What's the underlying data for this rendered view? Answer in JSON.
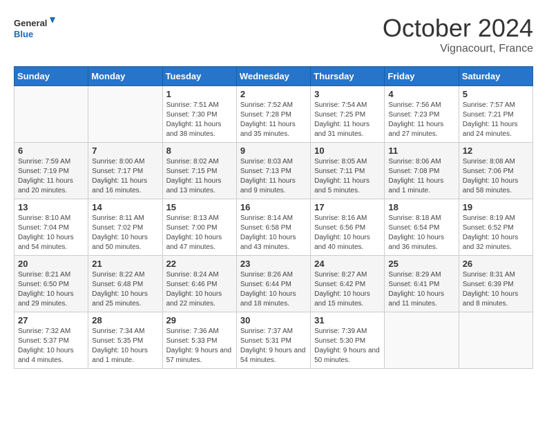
{
  "header": {
    "logo_line1": "General",
    "logo_line2": "Blue",
    "month": "October 2024",
    "location": "Vignacourt, France"
  },
  "weekdays": [
    "Sunday",
    "Monday",
    "Tuesday",
    "Wednesday",
    "Thursday",
    "Friday",
    "Saturday"
  ],
  "weeks": [
    [
      {
        "day": "",
        "info": ""
      },
      {
        "day": "",
        "info": ""
      },
      {
        "day": "1",
        "info": "Sunrise: 7:51 AM\nSunset: 7:30 PM\nDaylight: 11 hours and 38 minutes."
      },
      {
        "day": "2",
        "info": "Sunrise: 7:52 AM\nSunset: 7:28 PM\nDaylight: 11 hours and 35 minutes."
      },
      {
        "day": "3",
        "info": "Sunrise: 7:54 AM\nSunset: 7:25 PM\nDaylight: 11 hours and 31 minutes."
      },
      {
        "day": "4",
        "info": "Sunrise: 7:56 AM\nSunset: 7:23 PM\nDaylight: 11 hours and 27 minutes."
      },
      {
        "day": "5",
        "info": "Sunrise: 7:57 AM\nSunset: 7:21 PM\nDaylight: 11 hours and 24 minutes."
      }
    ],
    [
      {
        "day": "6",
        "info": "Sunrise: 7:59 AM\nSunset: 7:19 PM\nDaylight: 11 hours and 20 minutes."
      },
      {
        "day": "7",
        "info": "Sunrise: 8:00 AM\nSunset: 7:17 PM\nDaylight: 11 hours and 16 minutes."
      },
      {
        "day": "8",
        "info": "Sunrise: 8:02 AM\nSunset: 7:15 PM\nDaylight: 11 hours and 13 minutes."
      },
      {
        "day": "9",
        "info": "Sunrise: 8:03 AM\nSunset: 7:13 PM\nDaylight: 11 hours and 9 minutes."
      },
      {
        "day": "10",
        "info": "Sunrise: 8:05 AM\nSunset: 7:11 PM\nDaylight: 11 hours and 5 minutes."
      },
      {
        "day": "11",
        "info": "Sunrise: 8:06 AM\nSunset: 7:08 PM\nDaylight: 11 hours and 1 minute."
      },
      {
        "day": "12",
        "info": "Sunrise: 8:08 AM\nSunset: 7:06 PM\nDaylight: 10 hours and 58 minutes."
      }
    ],
    [
      {
        "day": "13",
        "info": "Sunrise: 8:10 AM\nSunset: 7:04 PM\nDaylight: 10 hours and 54 minutes."
      },
      {
        "day": "14",
        "info": "Sunrise: 8:11 AM\nSunset: 7:02 PM\nDaylight: 10 hours and 50 minutes."
      },
      {
        "day": "15",
        "info": "Sunrise: 8:13 AM\nSunset: 7:00 PM\nDaylight: 10 hours and 47 minutes."
      },
      {
        "day": "16",
        "info": "Sunrise: 8:14 AM\nSunset: 6:58 PM\nDaylight: 10 hours and 43 minutes."
      },
      {
        "day": "17",
        "info": "Sunrise: 8:16 AM\nSunset: 6:56 PM\nDaylight: 10 hours and 40 minutes."
      },
      {
        "day": "18",
        "info": "Sunrise: 8:18 AM\nSunset: 6:54 PM\nDaylight: 10 hours and 36 minutes."
      },
      {
        "day": "19",
        "info": "Sunrise: 8:19 AM\nSunset: 6:52 PM\nDaylight: 10 hours and 32 minutes."
      }
    ],
    [
      {
        "day": "20",
        "info": "Sunrise: 8:21 AM\nSunset: 6:50 PM\nDaylight: 10 hours and 29 minutes."
      },
      {
        "day": "21",
        "info": "Sunrise: 8:22 AM\nSunset: 6:48 PM\nDaylight: 10 hours and 25 minutes."
      },
      {
        "day": "22",
        "info": "Sunrise: 8:24 AM\nSunset: 6:46 PM\nDaylight: 10 hours and 22 minutes."
      },
      {
        "day": "23",
        "info": "Sunrise: 8:26 AM\nSunset: 6:44 PM\nDaylight: 10 hours and 18 minutes."
      },
      {
        "day": "24",
        "info": "Sunrise: 8:27 AM\nSunset: 6:42 PM\nDaylight: 10 hours and 15 minutes."
      },
      {
        "day": "25",
        "info": "Sunrise: 8:29 AM\nSunset: 6:41 PM\nDaylight: 10 hours and 11 minutes."
      },
      {
        "day": "26",
        "info": "Sunrise: 8:31 AM\nSunset: 6:39 PM\nDaylight: 10 hours and 8 minutes."
      }
    ],
    [
      {
        "day": "27",
        "info": "Sunrise: 7:32 AM\nSunset: 5:37 PM\nDaylight: 10 hours and 4 minutes."
      },
      {
        "day": "28",
        "info": "Sunrise: 7:34 AM\nSunset: 5:35 PM\nDaylight: 10 hours and 1 minute."
      },
      {
        "day": "29",
        "info": "Sunrise: 7:36 AM\nSunset: 5:33 PM\nDaylight: 9 hours and 57 minutes."
      },
      {
        "day": "30",
        "info": "Sunrise: 7:37 AM\nSunset: 5:31 PM\nDaylight: 9 hours and 54 minutes."
      },
      {
        "day": "31",
        "info": "Sunrise: 7:39 AM\nSunset: 5:30 PM\nDaylight: 9 hours and 50 minutes."
      },
      {
        "day": "",
        "info": ""
      },
      {
        "day": "",
        "info": ""
      }
    ]
  ]
}
